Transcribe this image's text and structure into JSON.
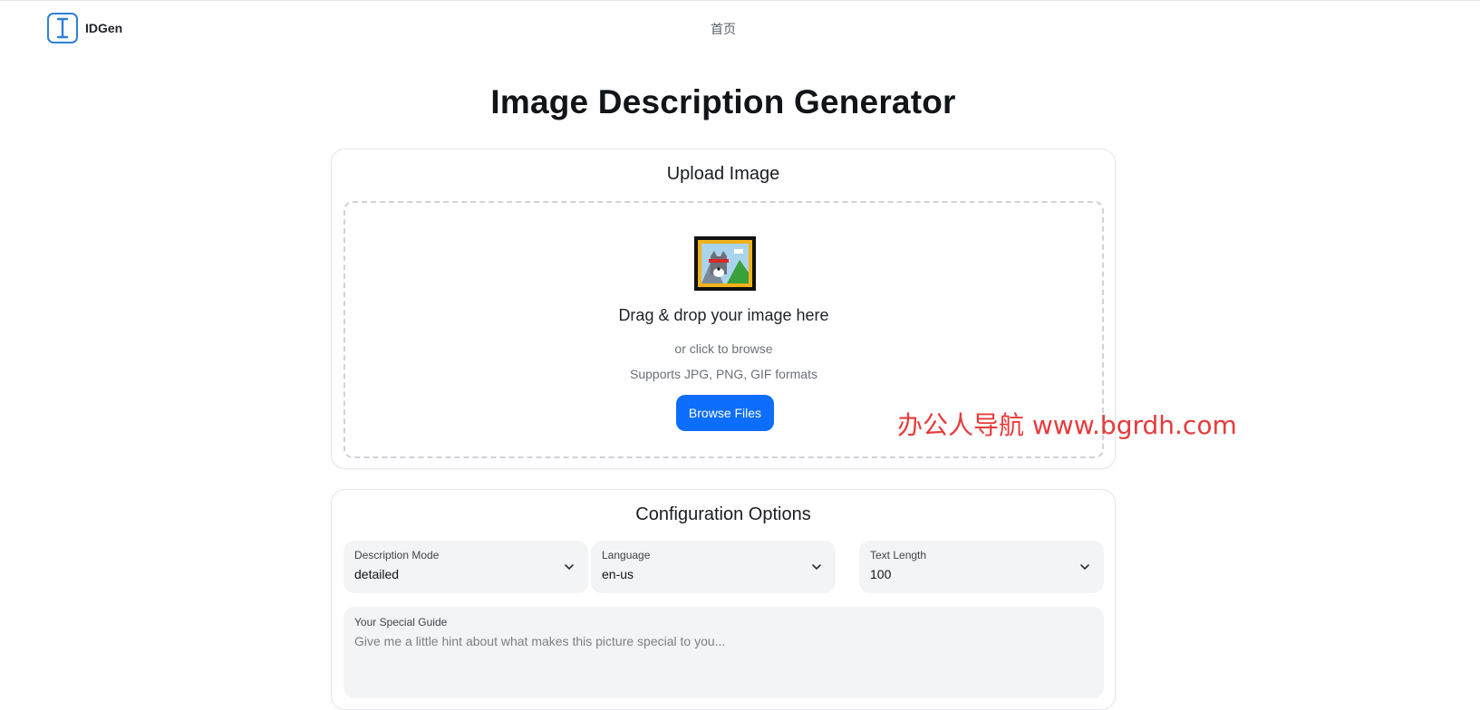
{
  "header": {
    "brand": "IDGen",
    "nav_home": "首页"
  },
  "main": {
    "title": "Image Description Generator"
  },
  "upload": {
    "title": "Upload Image",
    "drop_text": "Drag & drop your image here",
    "browse_hint": "or click to browse",
    "formats": "Supports JPG, PNG, GIF formats",
    "browse_button": "Browse Files",
    "icon": "framed-picture-icon"
  },
  "config": {
    "title": "Configuration Options",
    "selects": [
      {
        "label": "Description Mode",
        "value": "detailed"
      },
      {
        "label": "Language",
        "value": "en-us"
      },
      {
        "label": "Text Length",
        "value": "100"
      }
    ],
    "guide": {
      "label": "Your Special Guide",
      "placeholder": "Give me a little hint about what makes this picture special to you..."
    }
  },
  "watermark": "办公人导航 www.bgrdh.com",
  "colors": {
    "accent": "#0d6efd",
    "logo": "#2f7fd8",
    "watermark": "#e63b3b"
  }
}
